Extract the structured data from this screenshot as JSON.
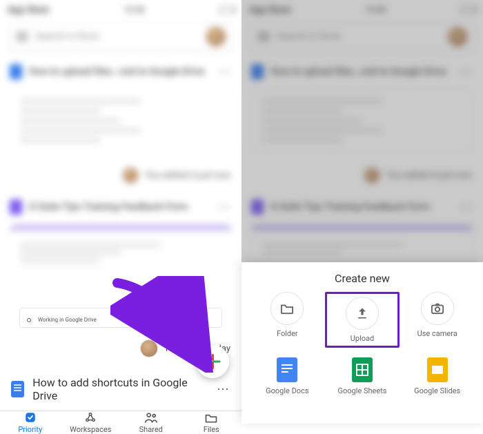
{
  "left": {
    "status": {
      "carrier": "App Store",
      "time": "16:38"
    },
    "search": {
      "placeholder": "Search in Drive"
    },
    "files": {
      "first": "How to upload files…roid to Google Drive",
      "second": "G Suite Tips Training Feedback Form",
      "footer_label": "Working in Google Drive"
    },
    "edit_note_blur": "You edited it just now",
    "edit_note": "You edited today",
    "row_title": "How to add shortcuts in Google Drive",
    "tabs": {
      "priority": "Priority",
      "workspaces": "Workspaces",
      "shared": "Shared",
      "files": "Files"
    }
  },
  "right": {
    "sheet": {
      "title": "Create new",
      "options": {
        "folder": "Folder",
        "upload": "Upload",
        "camera": "Use camera",
        "docs": "Google Docs",
        "sheets": "Google Sheets",
        "slides": "Google Slides"
      }
    }
  }
}
